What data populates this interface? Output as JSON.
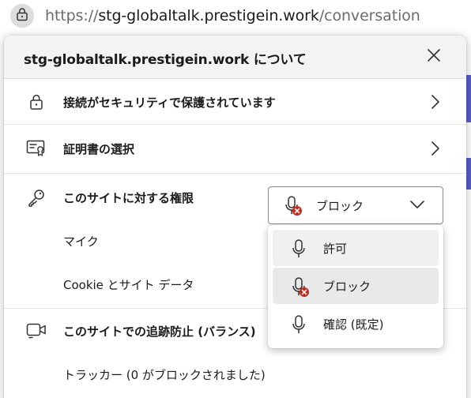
{
  "address_bar": {
    "url_scheme": "https://",
    "url_host": "stg-globaltalk.prestigein.work",
    "url_path": "/conversation"
  },
  "flyout": {
    "title": "stg-globaltalk.prestigein.work について",
    "connection_label": "接続がセキュリティで保護されています",
    "certificate_label": "証明書の選択",
    "permissions_heading": "このサイトに対する権限",
    "mic_label": "マイク",
    "mic_selected": "ブロック",
    "cookie_label": "Cookie とサイト データ",
    "tracking_heading": "このサイトでの追跡防止 (バランス)",
    "trackers_label": "トラッカー (0 がブロックされました)"
  },
  "mic_options": [
    {
      "label": "許可",
      "icon": "mic-icon"
    },
    {
      "label": "ブロック",
      "icon": "mic-blocked-icon"
    },
    {
      "label": "確認 (既定)",
      "icon": "mic-icon"
    }
  ],
  "colors": {
    "block_badge": "#c42b1c",
    "header_bg": "#f3f3f3"
  }
}
